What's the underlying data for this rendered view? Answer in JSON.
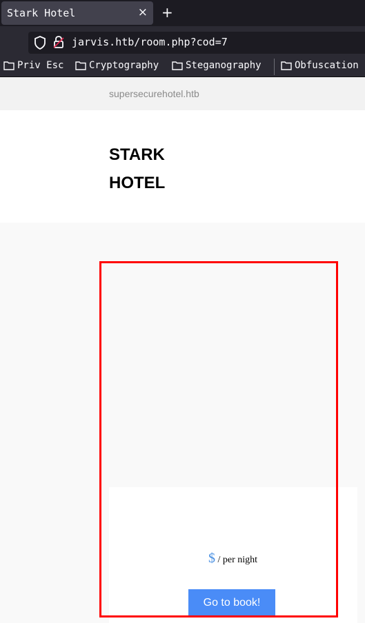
{
  "browser": {
    "tab_title": "Stark Hotel",
    "tab_close": "×",
    "new_tab": "+",
    "url": "jarvis.htb/room.php?cod=7",
    "bookmarks": [
      "Priv Esc",
      "Cryptography",
      "Steganography",
      "Obfuscation"
    ]
  },
  "site": {
    "domain": "supersecurehotel.htb",
    "brand_line1": "STARK",
    "brand_line2": "HOTEL"
  },
  "room": {
    "currency": "$",
    "per_night": "/ per night",
    "book_label": "Go to book!"
  },
  "colors": {
    "accent": "#4a8cf7",
    "highlight": "#ff0000"
  }
}
